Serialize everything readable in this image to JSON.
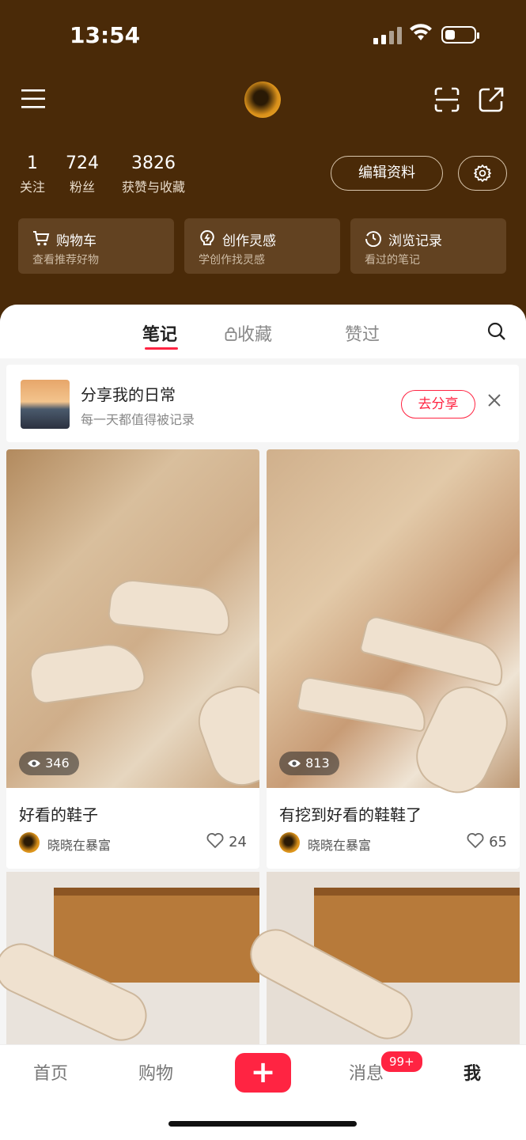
{
  "status_bar": {
    "time": "13:54"
  },
  "profile": {
    "stats": [
      {
        "value": "1",
        "label": "关注"
      },
      {
        "value": "724",
        "label": "粉丝"
      },
      {
        "value": "3826",
        "label": "获赞与收藏"
      }
    ],
    "edit_label": "编辑资料"
  },
  "cards": [
    {
      "title": "购物车",
      "subtitle": "查看推荐好物",
      "icon": "cart-icon"
    },
    {
      "title": "创作灵感",
      "subtitle": "学创作找灵感",
      "icon": "bulb-icon"
    },
    {
      "title": "浏览记录",
      "subtitle": "看过的笔记",
      "icon": "clock-icon"
    }
  ],
  "tabs": [
    {
      "label": "笔记",
      "active": true
    },
    {
      "label": "收藏",
      "locked": true
    },
    {
      "label": "赞过"
    }
  ],
  "share_prompt": {
    "title": "分享我的日常",
    "subtitle": "每一天都值得被记录",
    "button": "去分享"
  },
  "notes": [
    {
      "title": "好看的鞋子",
      "views": "346",
      "author": "晓晓在暴富",
      "likes": "24"
    },
    {
      "title": "有挖到好看的鞋鞋了",
      "views": "813",
      "author": "晓晓在暴富",
      "likes": "65"
    }
  ],
  "bottom_nav": {
    "items": [
      "首页",
      "购物",
      "消息",
      "我"
    ],
    "plus": "+",
    "badge": "99+"
  },
  "colors": {
    "header_bg": "#4a2a08",
    "accent": "#ff2442",
    "card_bg": "#624221"
  }
}
